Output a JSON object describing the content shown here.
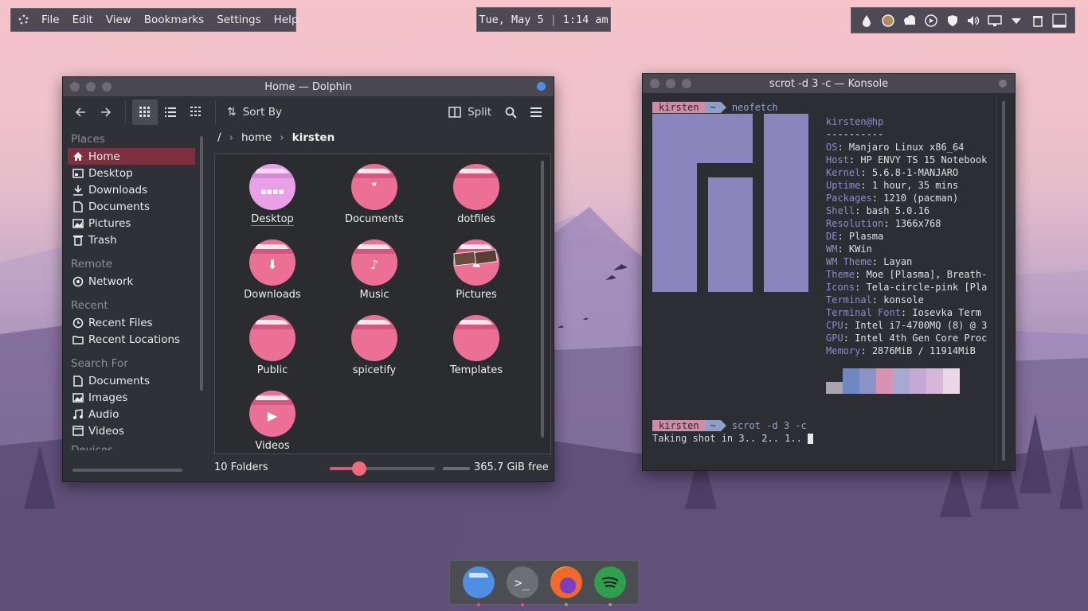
{
  "menubar": {
    "items": [
      "File",
      "Edit",
      "View",
      "Bookmarks",
      "Settings",
      "Help"
    ]
  },
  "clock": {
    "date": "Tue, May 5",
    "time": "1:14 am"
  },
  "tray": {
    "icons": [
      "droplet-icon",
      "circle-icon",
      "cloud-icon",
      "play-icon",
      "shield-icon",
      "volume-icon",
      "display-icon",
      "chevron-down-icon",
      "trash-icon",
      "window-icon"
    ]
  },
  "dolphin": {
    "title": "Home — Dolphin",
    "toolbar": {
      "sort_label": "Sort By",
      "split_label": "Split"
    },
    "sidebar": {
      "sections": [
        {
          "header": "Places",
          "items": [
            "Home",
            "Desktop",
            "Downloads",
            "Documents",
            "Pictures",
            "Trash"
          ]
        },
        {
          "header": "Remote",
          "items": [
            "Network"
          ]
        },
        {
          "header": "Recent",
          "items": [
            "Recent Files",
            "Recent Locations"
          ]
        },
        {
          "header": "Search For",
          "items": [
            "Documents",
            "Images",
            "Audio",
            "Videos"
          ]
        },
        {
          "header": "Devices",
          "items": []
        }
      ]
    },
    "breadcrumb": {
      "root": "/",
      "home": "home",
      "current": "kirsten"
    },
    "folders": [
      "Desktop",
      "Documents",
      "dotfiles",
      "Downloads",
      "Music",
      "Pictures",
      "Public",
      "spicetify",
      "Templates",
      "Videos"
    ],
    "status": {
      "count": "10 Folders",
      "free": "365.7 GiB free",
      "zoom_fraction": 0.28
    },
    "colors": {
      "folder": "#ec6f96",
      "desktop_folder": "#e8a0e6",
      "selection": "#7e3040"
    }
  },
  "konsole": {
    "title": "scrot -d 3 -c — Konsole",
    "prompt_user": "kirsten",
    "prompt_dir": "~",
    "cmd1": "neofetch",
    "user_host": "kirsten@hp",
    "separator": "----------",
    "info": [
      {
        "k": "OS",
        "v": "Manjaro Linux x86_64"
      },
      {
        "k": "Host",
        "v": "HP ENVY TS 15 Notebook"
      },
      {
        "k": "Kernel",
        "v": "5.6.8-1-MANJARO"
      },
      {
        "k": "Uptime",
        "v": "1 hour, 35 mins"
      },
      {
        "k": "Packages",
        "v": "1210 (pacman)"
      },
      {
        "k": "Shell",
        "v": "bash 5.0.16"
      },
      {
        "k": "Resolution",
        "v": "1366x768"
      },
      {
        "k": "DE",
        "v": "Plasma"
      },
      {
        "k": "WM",
        "v": "KWin"
      },
      {
        "k": "WM Theme",
        "v": "Layan"
      },
      {
        "k": "Theme",
        "v": "Moe [Plasma], Breath-"
      },
      {
        "k": "Icons",
        "v": "Tela-circle-pink [Pla"
      },
      {
        "k": "Terminal",
        "v": "konsole"
      },
      {
        "k": "Terminal Font",
        "v": "Iosevka Term"
      },
      {
        "k": "CPU",
        "v": "Intel i7-4700MQ (8) @ 3"
      },
      {
        "k": "GPU",
        "v": "Intel 4th Gen Core Proc"
      },
      {
        "k": "Memory",
        "v": "2876MiB / 11914MiB"
      }
    ],
    "palette": [
      "#aaa3b0",
      "#6f87c2",
      "#8b93c4",
      "#d693b4",
      "#a8a9d3",
      "#c5a8d3",
      "#d7b6d8",
      "#e9d7e8"
    ],
    "cmd2": "scrot -d 3 -c",
    "output": "Taking shot in 3.. 2.. 1.. "
  },
  "dock": {
    "apps": [
      "dolphin-icon",
      "konsole-icon",
      "firefox-icon",
      "spotify-icon"
    ]
  }
}
